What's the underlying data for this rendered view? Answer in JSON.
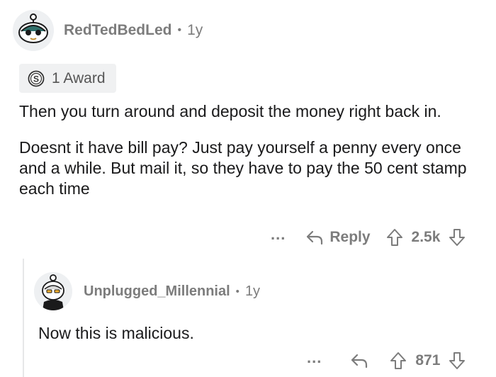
{
  "comment1": {
    "author": "RedTedBedLed",
    "separator": "•",
    "age": "1y",
    "award_label": "1 Award",
    "paragraphs": [
      "Then you turn around and deposit the money right back in.",
      "Doesnt it have bill pay? Just pay yourself a penny every once and a while. But mail it, so they have to pay the 50 cent stamp each time"
    ],
    "more": "...",
    "reply_label": "Reply",
    "score": "2.5k"
  },
  "comment2": {
    "author": "Unplugged_Millennial",
    "separator": "•",
    "age": "1y",
    "text": "Now this is malicious.",
    "more": "...",
    "score": "871"
  },
  "icons": {
    "more": "more-options-icon",
    "reply": "reply-arrow-icon",
    "upvote": "upvote-arrow-icon",
    "downvote": "downvote-arrow-icon",
    "award": "award-coin-icon"
  }
}
